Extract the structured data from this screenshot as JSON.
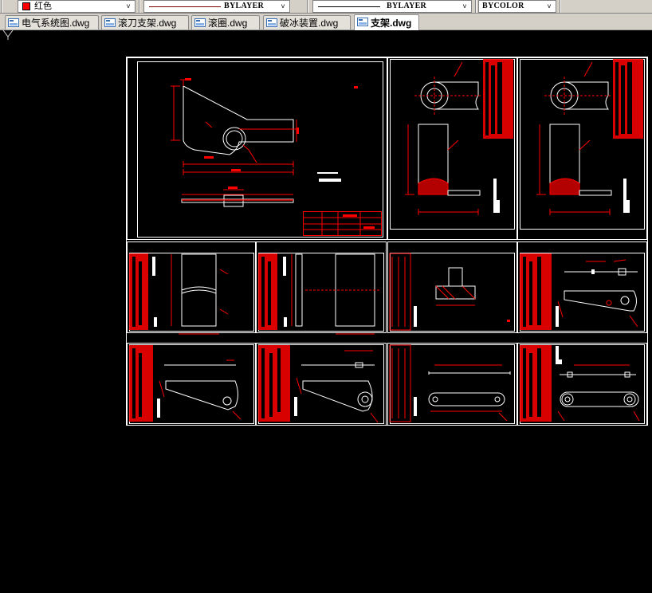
{
  "toolbar": {
    "color_label": "红色",
    "color_swatch": "#ff0000",
    "linetype_label": "BYLAYER",
    "lineweight_label": "BYLAYER",
    "plotstyle_label": "BYCOLOR"
  },
  "tabs": [
    {
      "label": "电气系统图.dwg",
      "active": false
    },
    {
      "label": "滚刀支架.dwg",
      "active": false
    },
    {
      "label": "滚圈.dwg",
      "active": false
    },
    {
      "label": "破冰装置.dwg",
      "active": false
    },
    {
      "label": "支架.dwg",
      "active": true
    }
  ],
  "colors": {
    "canvas_bg": "#000000",
    "frame": "#ffffff",
    "dimension": "#ff0000",
    "geometry": "#ffffff"
  },
  "icons": {
    "file_tab": "dwg-file-icon",
    "dropdown": "chevron-down-icon",
    "ucs": "ucs-axis-icon"
  }
}
